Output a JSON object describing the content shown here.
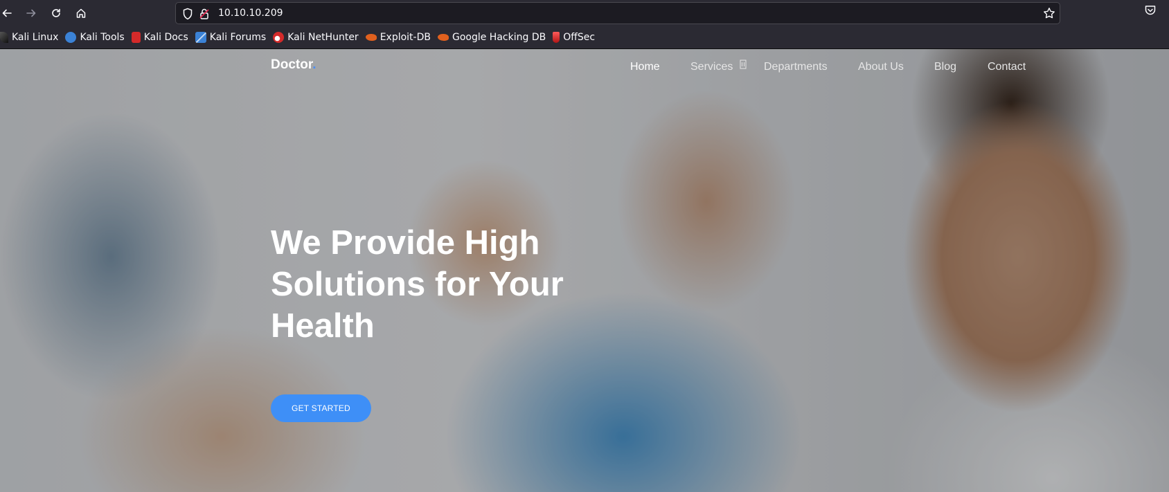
{
  "browser": {
    "url": "10.10.10.209",
    "bookmarks": [
      {
        "label": "Kali Linux",
        "icon": "kali-dragon-icon",
        "color": "#2a2a2a"
      },
      {
        "label": "Kali Tools",
        "icon": "kali-tools-icon",
        "color": "#3b82d6"
      },
      {
        "label": "Kali Docs",
        "icon": "kali-docs-icon",
        "color": "#d42a2a"
      },
      {
        "label": "Kali Forums",
        "icon": "kali-forums-icon",
        "color": "#3b82d6"
      },
      {
        "label": "Kali NetHunter",
        "icon": "kali-nethunter-icon",
        "color": "#d42a2a"
      },
      {
        "label": "Exploit-DB",
        "icon": "exploit-db-icon",
        "color": "#e0601e"
      },
      {
        "label": "Google Hacking DB",
        "icon": "ghdb-icon",
        "color": "#e0601e"
      },
      {
        "label": "OffSec",
        "icon": "offsec-icon",
        "color": "#d42a2a"
      }
    ]
  },
  "site": {
    "brand": "Doctor",
    "brand_dot": ".",
    "accent": "#3e8ff7",
    "menu": [
      {
        "label": "Home",
        "active": true
      },
      {
        "label": "Services",
        "active": false,
        "badge_icon": "dropdown-indicator-icon"
      },
      {
        "label": "Departments",
        "active": false
      },
      {
        "label": "About Us",
        "active": false
      },
      {
        "label": "Blog",
        "active": false
      },
      {
        "label": "Contact",
        "active": false
      }
    ],
    "hero": {
      "line1": "We Provide High",
      "line2": "Solutions for Your",
      "line3": "Health",
      "cta": "GET STARTED"
    }
  }
}
